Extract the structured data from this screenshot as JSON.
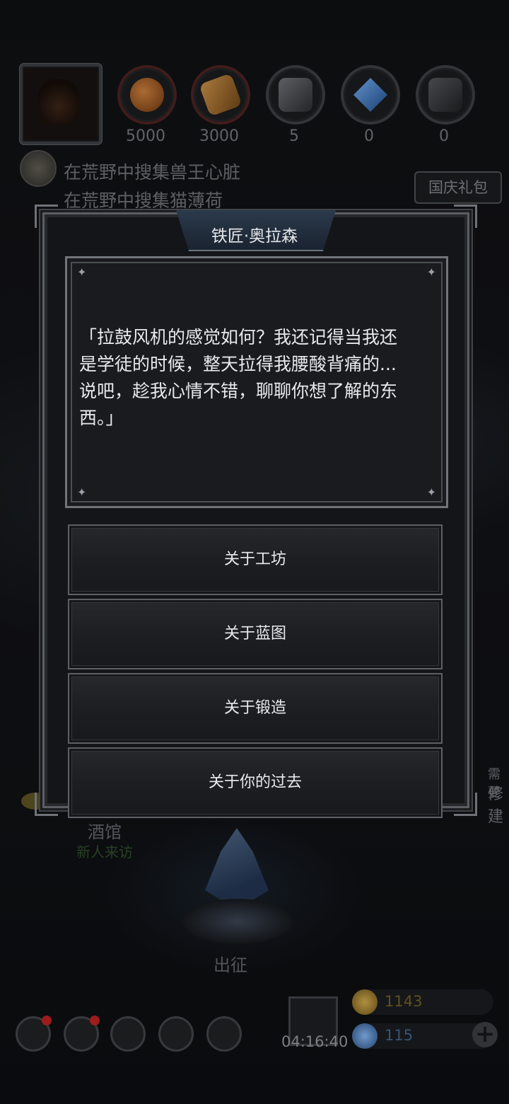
{
  "resources": [
    {
      "icon": "meat-icon",
      "value": "5000",
      "color": "#8a4a20"
    },
    {
      "icon": "wood-icon",
      "value": "3000",
      "color": "#9a6a30"
    },
    {
      "icon": "iron-icon",
      "value": "5",
      "color": "#555555"
    },
    {
      "icon": "crystal-shard-icon",
      "value": "0",
      "color": "#3a6fb0"
    },
    {
      "icon": "ore-icon",
      "value": "0",
      "color": "#444444"
    }
  ],
  "quests": [
    "在荒野中搜集兽王心脏",
    "在荒野中搜集猫薄荷"
  ],
  "gift_button": "国庆礼包",
  "background_labels": {
    "tavern": "酒馆",
    "tavern_sub": "新人来访",
    "expedition": "出征",
    "side_need": "需要",
    "side_repair": "修建"
  },
  "dialog": {
    "title": "铁匠·奥拉森",
    "speech": "「拉鼓风机的感觉如何？我还记得当我还\n是学徒的时候，整天拉得我腰酸背痛的...\n说吧，趁我心情不错，聊聊你想了解的东\n西。」",
    "options": [
      "关于工坊",
      "关于蓝图",
      "关于锻造",
      "关于你的过去"
    ]
  },
  "bottom": {
    "timer": "04:16:40",
    "gold": "1143",
    "gems": "115"
  },
  "colors": {
    "gold_text": "#6b5a22",
    "gem_text": "#3d5f88",
    "badge": "#b32020"
  }
}
